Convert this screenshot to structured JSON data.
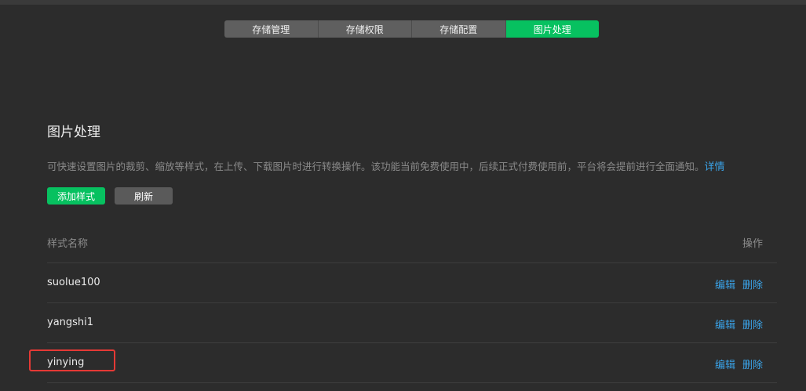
{
  "tabs": [
    {
      "label": "存储管理",
      "active": false
    },
    {
      "label": "存储权限",
      "active": false
    },
    {
      "label": "存储配置",
      "active": false
    },
    {
      "label": "图片处理",
      "active": true
    }
  ],
  "page": {
    "title": "图片处理",
    "description": "可快速设置图片的裁剪、缩放等样式，在上传、下载图片时进行转换操作。该功能当前免费使用中，后续正式付费使用前，平台将会提前进行全面通知。",
    "details_link": "详情"
  },
  "toolbar": {
    "add_label": "添加样式",
    "refresh_label": "刷新"
  },
  "table": {
    "headers": {
      "name": "样式名称",
      "operations": "操作"
    },
    "rows": [
      {
        "name": "suolue100",
        "edit": "编辑",
        "delete": "删除"
      },
      {
        "name": "yangshi1",
        "edit": "编辑",
        "delete": "删除"
      },
      {
        "name": "yinying",
        "edit": "编辑",
        "delete": "删除"
      }
    ]
  },
  "colors": {
    "background": "#2c2c2c",
    "accent": "#07c160",
    "link": "#3aa3e8",
    "highlight": "#e53935"
  }
}
